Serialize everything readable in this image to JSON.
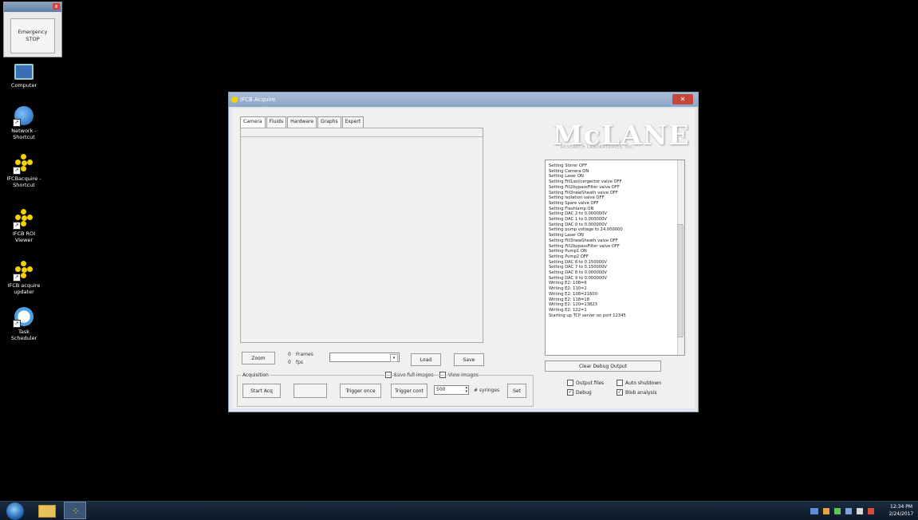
{
  "emergency_stop": {
    "label": "Emergency\nSTOP"
  },
  "desktop_icons": [
    {
      "label": "Computer"
    },
    {
      "label": "Network -\nShortcut"
    },
    {
      "label": "IFCBacquire -\nShortcut"
    },
    {
      "label": "IFCB ROI\nViewer"
    },
    {
      "label": "IFCB acquire\nupdater"
    },
    {
      "label": "Task\nScheduler"
    }
  ],
  "window": {
    "title": "IFCB Acquire"
  },
  "tabs": [
    "Camera",
    "Fluids",
    "Hardware",
    "Graphs",
    "Expert"
  ],
  "camera": {
    "zoom_label": "Zoom",
    "frames_value": "0",
    "frames_label": "Frames",
    "fps_value": "0",
    "fps_label": "fps",
    "load_label": "Load",
    "save_label": "Save",
    "save_full_images": "Save full images",
    "view_images": "View images"
  },
  "acquisition": {
    "group_label": "Acquisition",
    "start_label": "Start Acq",
    "trigger_once_label": "Trigger once",
    "trigger_cont_label": "Trigger cont",
    "syringe_value": "500",
    "syringes_label": "# syringes",
    "set_label": "Set"
  },
  "logo": {
    "text": "McLANE",
    "sub": "RESEARCH LABORATORIES, INC."
  },
  "debug_lines": [
    "Setting Stirrer OFF",
    "Setting Camera ON",
    "Setting Laser ON",
    "Setting Fill1sol/cergector valve OFF",
    "Setting Fill2bypassFilter valve OFF",
    "Setting Fill3newSheath valve OFF",
    "Setting Isolation valve OFF",
    "Setting Spare valve OFF",
    "Setting Flashlamp ON",
    "Setting DAC 2 to 0.000000V",
    "Setting DAC 1 to 0.000000V",
    "Setting DAC 0 to 0.000000V",
    "Setting pump voltage to 24.000000",
    "Setting Laser ON",
    "Setting Fill3newSheath valve OFF",
    "Setting Fill2bypassFilter valve OFF",
    "Setting Pump1 ON",
    "Setting Pump2 OFF",
    "Setting DAC 6 to 0.150000V",
    "Setting DAC 7 to 0.150000V",
    "Setting DAC 8 to 0.000000V",
    "Setting DAC 9 to 0.000000V",
    "Writing E2: 108=6",
    "Writing E2: 110=2",
    "Writing E2: 108=21600",
    "Writing E2: 118=18",
    "Writing E2: 120=13823",
    "Writing E2: 122=1",
    "Starting up TCP server on port 12345"
  ],
  "right_panel": {
    "clear_label": "Clear Debug Output",
    "output_files": "Output files",
    "auto_shutdown": "Auto shutdown",
    "debug": "Debug",
    "blob_analysis": "Blob analysis"
  },
  "taskbar": {
    "time": "12:34 PM",
    "date": "2/24/2017"
  },
  "colors": {
    "desktop": "#000000",
    "taskbar": "#0e1a2a",
    "icon_accent": "#f3d200"
  }
}
